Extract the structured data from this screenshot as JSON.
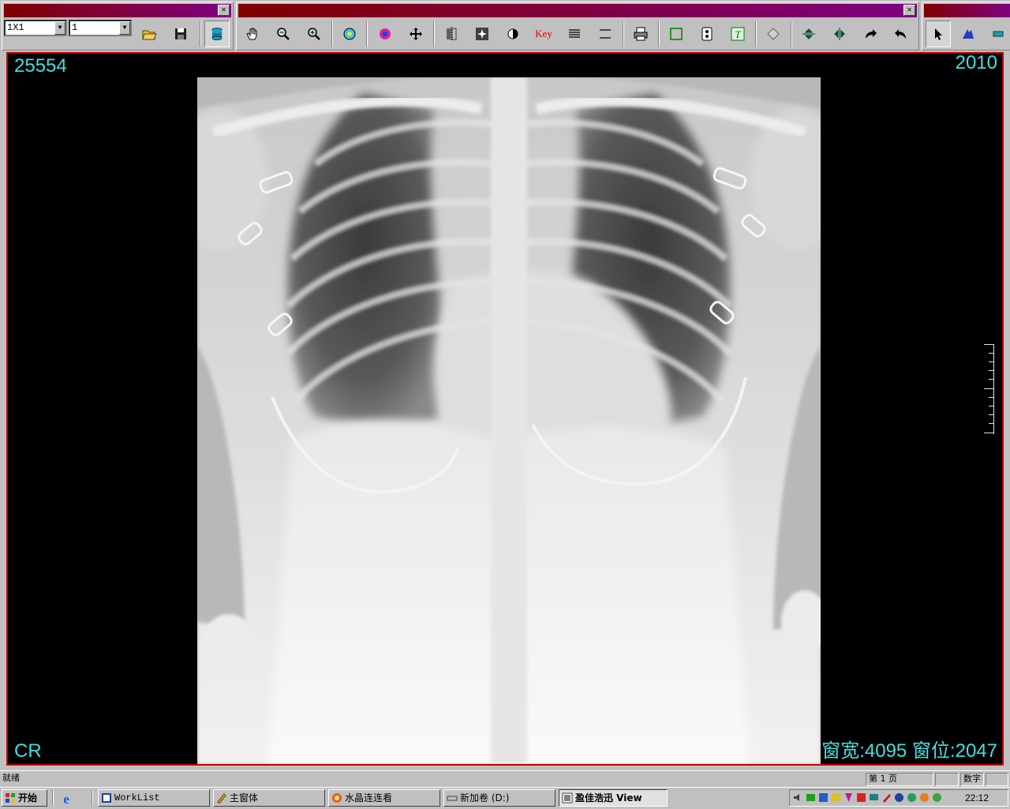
{
  "toolbar": {
    "layout_combo": {
      "value": "1X1"
    },
    "series_combo": {
      "value": "1"
    },
    "key_button_label": "Key",
    "icons": [
      "open-folder-icon",
      "save-icon",
      "database-icon",
      "pan-hand-icon",
      "zoom-out-icon",
      "zoom-in-icon",
      "window-level-icon",
      "color-icon",
      "move-icon",
      "flip-icon",
      "sharpen-icon",
      "invert-icon",
      "key-image",
      "align-icon",
      "line-icon",
      "print-icon",
      "rectangle-icon",
      "measure-icon",
      "text-annotation-icon",
      "diamond-icon",
      "rotate-left-icon",
      "rotate-right-icon",
      "redo-icon",
      "undo-icon",
      "pointer-icon",
      "magic-icon",
      "stack-icon"
    ]
  },
  "viewer": {
    "top_left": "25554",
    "top_right": "2010",
    "bottom_left": "CR",
    "bottom_right": "窗宽:4095 窗位:2047",
    "image_description": "chest x-ray",
    "overlay_color": "#40e0e0",
    "border_color": "#c00000"
  },
  "statusbar": {
    "status": "就绪",
    "page": "第 1 页",
    "mode": "数字"
  },
  "taskbar": {
    "start_label": "开始",
    "tasks": [
      {
        "label": "WorkList"
      },
      {
        "label": "主窗体"
      },
      {
        "label": "水晶连连看"
      },
      {
        "label": "新加卷 (D:)"
      },
      {
        "label": "盈佳浩迅 View"
      }
    ],
    "clock": "22:12"
  }
}
